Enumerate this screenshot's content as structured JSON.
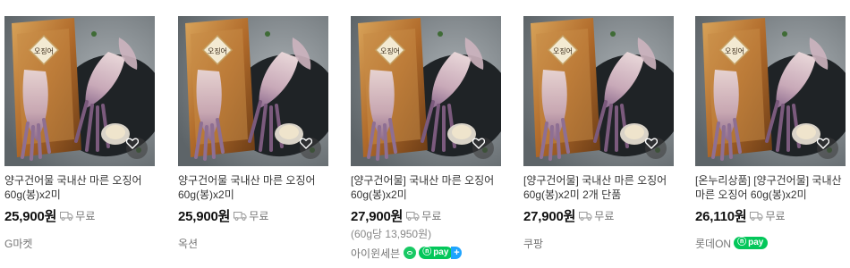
{
  "icons": {
    "favorite": "heart-icon",
    "shipping": "truck-icon"
  },
  "colors": {
    "npay_green": "#03c75a",
    "npay_plus_blue": "#1ea4ff",
    "talk_green": "#18c964"
  },
  "products": [
    {
      "title": "양구건어물 국내산 마른 오징어 60g(봉)x2미",
      "price": "25,900원",
      "shipping": "무료",
      "unit_price": "",
      "seller": "G마켓",
      "badges": []
    },
    {
      "title": "양구건어물 국내산 마른 오징어 60g(봉)x2미",
      "price": "25,900원",
      "shipping": "무료",
      "unit_price": "",
      "seller": "옥션",
      "badges": []
    },
    {
      "title": "[양구건어물] 국내산 마른 오징어 60g(봉)x2미",
      "price": "27,900원",
      "shipping": "무료",
      "unit_price": "(60g당 13,950원)",
      "seller": "아이윈세븐",
      "badges": [
        "talk",
        "npay",
        "npay-plus"
      ]
    },
    {
      "title": "[양구건어물] 국내산 마른 오징어 60g(봉)x2미 2개 단품",
      "price": "27,900원",
      "shipping": "무료",
      "unit_price": "",
      "seller": "쿠팡",
      "badges": []
    },
    {
      "title": "[온누리상품] [양구건어물] 국내산 마른 오징어 60g(봉)x2미",
      "price": "26,110원",
      "shipping": "무료",
      "unit_price": "",
      "seller": "롯데ON",
      "badges": [
        "npay"
      ]
    }
  ],
  "product_image": {
    "package_label": "오징어"
  },
  "npay_label": "pay"
}
